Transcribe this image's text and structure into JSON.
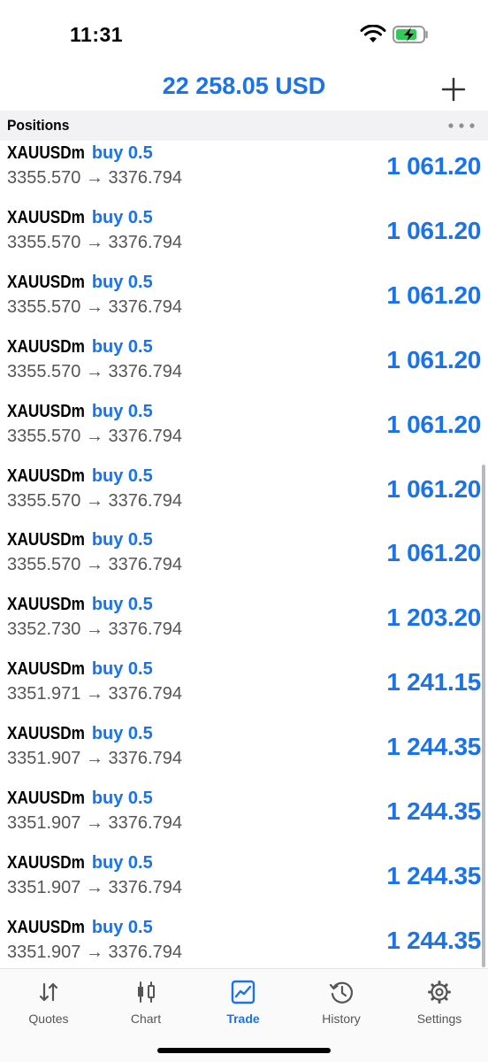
{
  "status": {
    "time": "11:31"
  },
  "header": {
    "balance": "22 258.05 USD"
  },
  "section": {
    "title": "Positions"
  },
  "positions": [
    {
      "symbol": "XAUUSDm",
      "side": "buy 0.5",
      "prices": "3355.570 → 3376.794",
      "profit": "1 061.20"
    },
    {
      "symbol": "XAUUSDm",
      "side": "buy 0.5",
      "prices": "3355.570 → 3376.794",
      "profit": "1 061.20"
    },
    {
      "symbol": "XAUUSDm",
      "side": "buy 0.5",
      "prices": "3355.570 → 3376.794",
      "profit": "1 061.20"
    },
    {
      "symbol": "XAUUSDm",
      "side": "buy 0.5",
      "prices": "3355.570 → 3376.794",
      "profit": "1 061.20"
    },
    {
      "symbol": "XAUUSDm",
      "side": "buy 0.5",
      "prices": "3355.570 → 3376.794",
      "profit": "1 061.20"
    },
    {
      "symbol": "XAUUSDm",
      "side": "buy 0.5",
      "prices": "3355.570 → 3376.794",
      "profit": "1 061.20"
    },
    {
      "symbol": "XAUUSDm",
      "side": "buy 0.5",
      "prices": "3355.570 → 3376.794",
      "profit": "1 061.20"
    },
    {
      "symbol": "XAUUSDm",
      "side": "buy 0.5",
      "prices": "3352.730 → 3376.794",
      "profit": "1 203.20"
    },
    {
      "symbol": "XAUUSDm",
      "side": "buy 0.5",
      "prices": "3351.971 → 3376.794",
      "profit": "1 241.15"
    },
    {
      "symbol": "XAUUSDm",
      "side": "buy 0.5",
      "prices": "3351.907 → 3376.794",
      "profit": "1 244.35"
    },
    {
      "symbol": "XAUUSDm",
      "side": "buy 0.5",
      "prices": "3351.907 → 3376.794",
      "profit": "1 244.35"
    },
    {
      "symbol": "XAUUSDm",
      "side": "buy 0.5",
      "prices": "3351.907 → 3376.794",
      "profit": "1 244.35"
    },
    {
      "symbol": "XAUUSDm",
      "side": "buy 0.5",
      "prices": "3351.907 → 3376.794",
      "profit": "1 244.35"
    }
  ],
  "tabs": [
    {
      "label": "Quotes",
      "icon": "quotes-icon"
    },
    {
      "label": "Chart",
      "icon": "chart-icon"
    },
    {
      "label": "Trade",
      "icon": "trade-icon",
      "active": true
    },
    {
      "label": "History",
      "icon": "history-icon"
    },
    {
      "label": "Settings",
      "icon": "gear-icon"
    }
  ],
  "colors": {
    "accent": "#1a73e8",
    "battery": "#34c759"
  }
}
